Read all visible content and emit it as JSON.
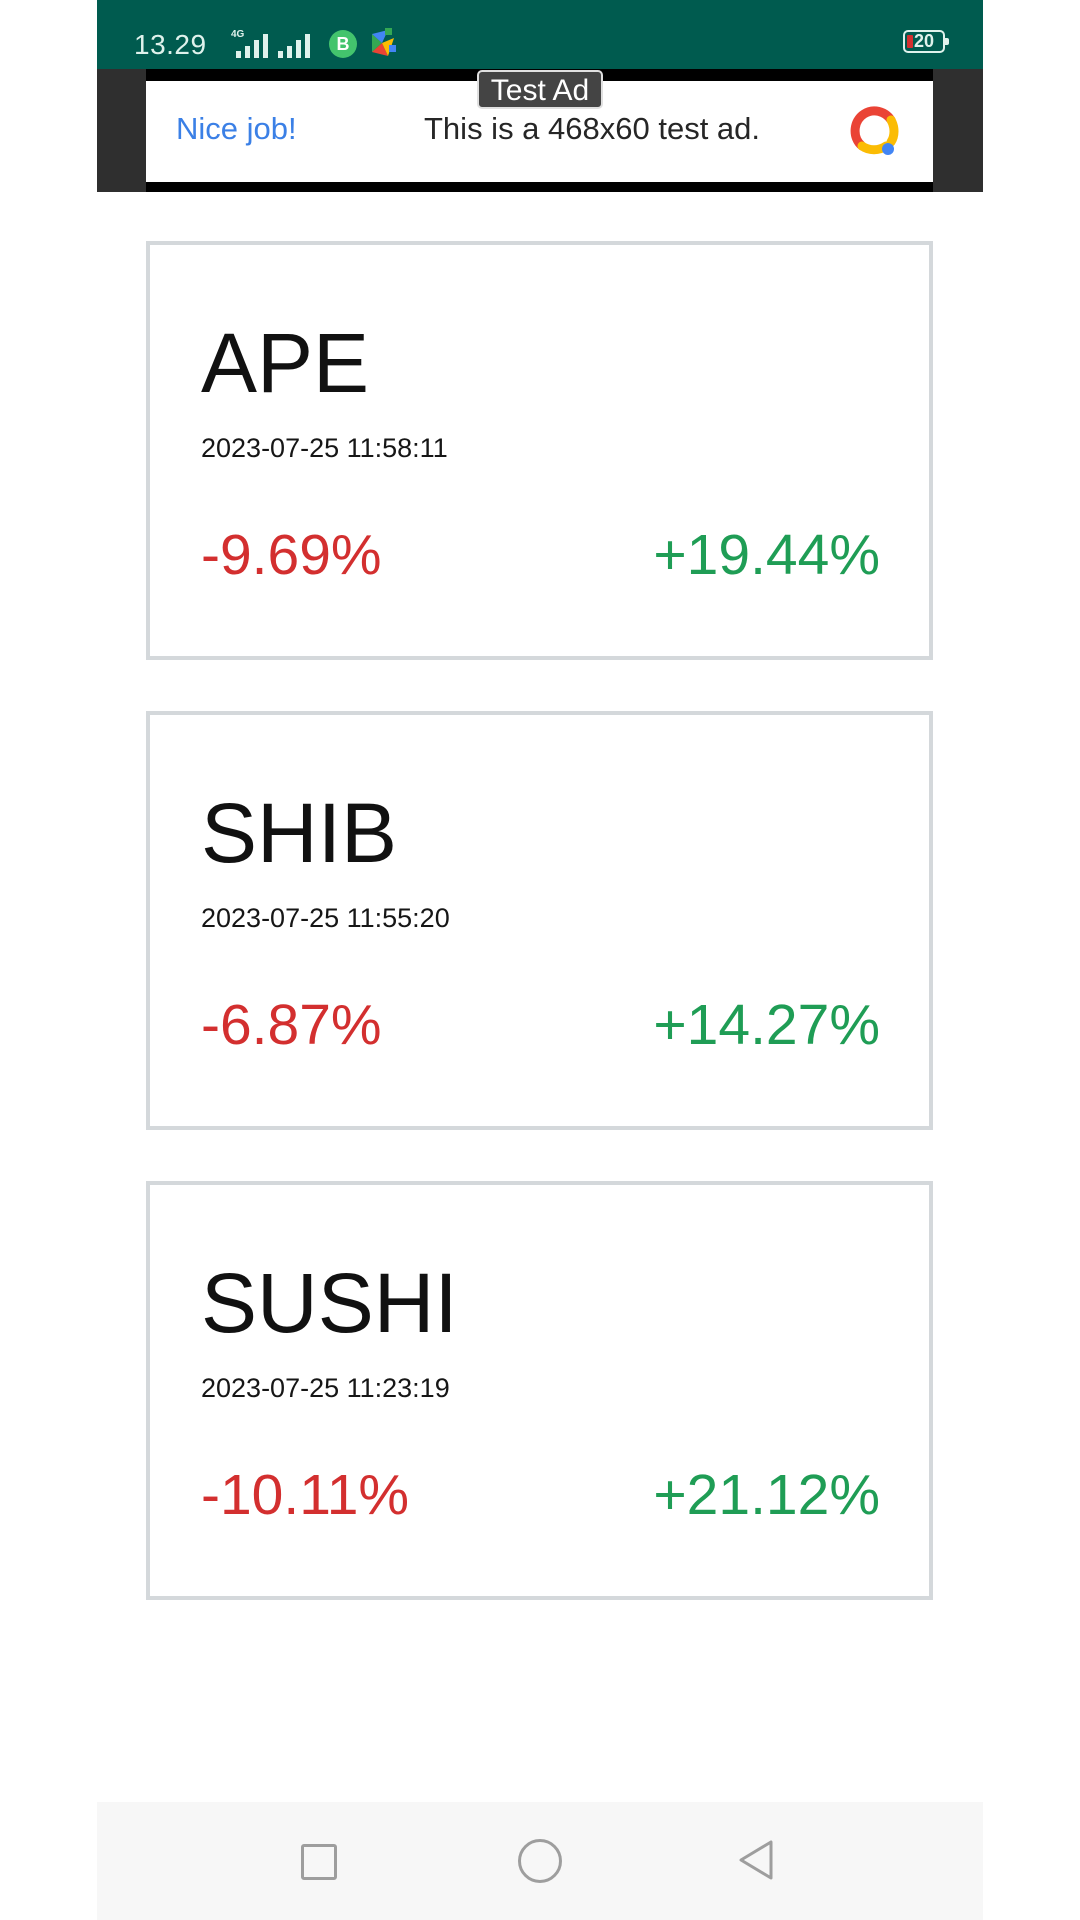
{
  "status_bar": {
    "time": "13.29",
    "network_label": "4G",
    "battery_level": "20"
  },
  "ad": {
    "badge": "Test Ad",
    "left_text": "Nice job!",
    "center_text": "This is a 468x60 test ad."
  },
  "cards": [
    {
      "symbol": "APE",
      "timestamp": "2023-07-25 11:58:11",
      "negative_change": "-9.69%",
      "positive_change": "+19.44%"
    },
    {
      "symbol": "SHIB",
      "timestamp": "2023-07-25 11:55:20",
      "negative_change": "-6.87%",
      "positive_change": "+14.27%"
    },
    {
      "symbol": "SUSHI",
      "timestamp": "2023-07-25 11:23:19",
      "negative_change": "-10.11%",
      "positive_change": "+21.12%"
    }
  ],
  "colors": {
    "status_bar": "#005b4f",
    "negative": "#d32f2f",
    "positive": "#1f9d55",
    "ad_link": "#3b80e6"
  }
}
